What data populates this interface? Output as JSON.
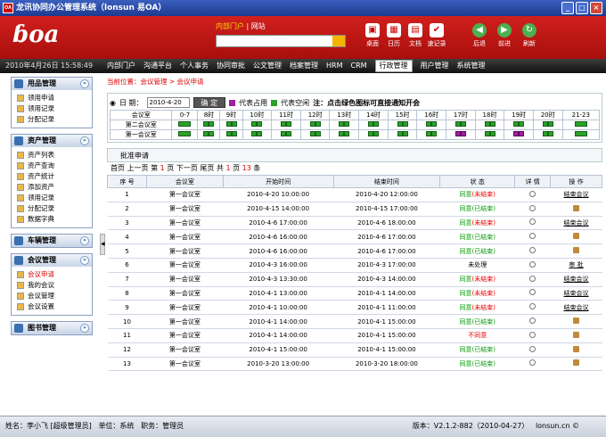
{
  "window": {
    "title": "龙讯协同办公管理系统（lonsun 易OA）",
    "app_icon": "OA"
  },
  "header": {
    "logo": "oa",
    "search_tabs": [
      "内部门户",
      "网站"
    ],
    "search_value": "",
    "icons": [
      {
        "name": "desktop-icon",
        "label": "桌面",
        "glyph": "▣"
      },
      {
        "name": "calendar-icon",
        "label": "日历",
        "glyph": "▦"
      },
      {
        "name": "document-icon",
        "label": "文档",
        "glyph": "▤"
      },
      {
        "name": "clipboard-icon",
        "label": "速记录",
        "glyph": "✔"
      }
    ],
    "nav": [
      {
        "name": "back-icon",
        "label": "后退",
        "glyph": "◀"
      },
      {
        "name": "forward-icon",
        "label": "前进",
        "glyph": "▶"
      },
      {
        "name": "refresh-icon",
        "label": "刷新",
        "glyph": "↻"
      }
    ]
  },
  "menubar": {
    "datetime": "2010年4月26日 15:58:49",
    "items": [
      "内部门户",
      "沟通平台",
      "个人事务",
      "协同审批",
      "公文管理",
      "档案管理",
      "HRM",
      "CRM",
      "行政管理",
      "用户管理",
      "系统管理"
    ],
    "active": "行政管理"
  },
  "sidebar": [
    {
      "title": "用品管理",
      "items": [
        "领用申请",
        "领用记录",
        "分配记录"
      ]
    },
    {
      "title": "资产管理",
      "items": [
        "资产列表",
        "资产查询",
        "资产统计",
        "添加资产",
        "领用记录",
        "分配记录",
        "数据字典"
      ]
    },
    {
      "title": "车辆管理",
      "items": []
    },
    {
      "title": "会议管理",
      "items": [
        "会议申请",
        "我的会议",
        "会议管理",
        "会议设置"
      ],
      "active": "会议申请"
    },
    {
      "title": "图书管理",
      "items": []
    }
  ],
  "breadcrumb": "当前位置：会议管理 > 会议申请",
  "booking": {
    "date_label": "日 期：",
    "date_value": "2010-4-20",
    "ok_label": "确 定",
    "legend_busy": "代表占用",
    "legend_free": "代表空闲",
    "note": "注：点击绿色图标可直接通知开会",
    "hours": [
      "0-7",
      "8时",
      "9时",
      "10时",
      "11时",
      "12时",
      "13时",
      "14时",
      "15时",
      "16时",
      "17时",
      "18时",
      "19时",
      "20时",
      "21-23"
    ],
    "room_header": "会议室",
    "rooms": [
      {
        "name": "第二会议室",
        "busy": []
      },
      {
        "name": "第一会议室",
        "busy": [
          10,
          12,
          14
        ]
      }
    ]
  },
  "list": {
    "title": "批准申请",
    "pager": {
      "nav": "首页 上一页 第",
      "page": "1",
      "mid": "页 下一页 尾页 共",
      "total_pages": "1",
      "mid2": "页",
      "count": "13",
      "end": "条"
    },
    "columns": [
      "序 号",
      "会议室",
      "开始时间",
      "结束时间",
      "状 态",
      "详 情",
      "操 作"
    ],
    "rows": [
      {
        "n": "1",
        "room": "第一会议室",
        "start": "2010-4-20 10:00:00",
        "end": "2010-4-20 12:00:00",
        "s1": "同意",
        "s2": "(未结束)",
        "op": "结束会议"
      },
      {
        "n": "2",
        "room": "第一会议室",
        "start": "2010-4-15 14:00:00",
        "end": "2010-4-15 17:00:00",
        "s1": "同意",
        "s2": "(已结束)",
        "op": ""
      },
      {
        "n": "3",
        "room": "第一会议室",
        "start": "2010-4-6 17:00:00",
        "end": "2010-4-6 18:00:00",
        "s1": "同意",
        "s2": "(未结束)",
        "op": "结束会议"
      },
      {
        "n": "4",
        "room": "第一会议室",
        "start": "2010-4-6 16:00:00",
        "end": "2010-4-6 17:00:00",
        "s1": "同意",
        "s2": "(已结束)",
        "op": ""
      },
      {
        "n": "5",
        "room": "第一会议室",
        "start": "2010-4-6 16:00:00",
        "end": "2010-4-6 17:00:00",
        "s1": "同意",
        "s2": "(已结束)",
        "op": ""
      },
      {
        "n": "6",
        "room": "第一会议室",
        "start": "2010-4-3 16:00:00",
        "end": "2010-4-3 17:00:00",
        "s1": "未处理",
        "s2": "",
        "op": "审 批"
      },
      {
        "n": "7",
        "room": "第一会议室",
        "start": "2010-4-3 13:30:00",
        "end": "2010-4-3 14:00:00",
        "s1": "同意",
        "s2": "(未结束)",
        "op": "结束会议"
      },
      {
        "n": "8",
        "room": "第一会议室",
        "start": "2010-4-1 13:00:00",
        "end": "2010-4-1 14:00:00",
        "s1": "同意",
        "s2": "(未结束)",
        "op": "结束会议"
      },
      {
        "n": "9",
        "room": "第一会议室",
        "start": "2010-4-1 10:00:00",
        "end": "2010-4-1 11:00:00",
        "s1": "同意",
        "s2": "(未结束)",
        "op": "结束会议"
      },
      {
        "n": "10",
        "room": "第一会议室",
        "start": "2010-4-1 14:00:00",
        "end": "2010-4-1 15:00:00",
        "s1": "同意",
        "s2": "(已结束)",
        "op": ""
      },
      {
        "n": "11",
        "room": "第一会议室",
        "start": "2010-4-1 14:00:00",
        "end": "2010-4-1 15:00:00",
        "s1": "不同意",
        "s2": "",
        "op": ""
      },
      {
        "n": "12",
        "room": "第一会议室",
        "start": "2010-4-1 15:00:00",
        "end": "2010-4-1 15:00:00",
        "s1": "同意",
        "s2": "(已结束)",
        "op": ""
      },
      {
        "n": "13",
        "room": "第一会议室",
        "start": "2010-3-20 13:00:00",
        "end": "2010-3-20 18:00:00",
        "s1": "同意",
        "s2": "(已结束)",
        "op": ""
      }
    ]
  },
  "status": {
    "user": "姓名：李小飞 [超级管理员]",
    "dept": "单位：系统",
    "role": "职务：管理员",
    "version": "版本：V2.1.2-882（2010-04-27）",
    "site": "lonsun.cn ©"
  }
}
